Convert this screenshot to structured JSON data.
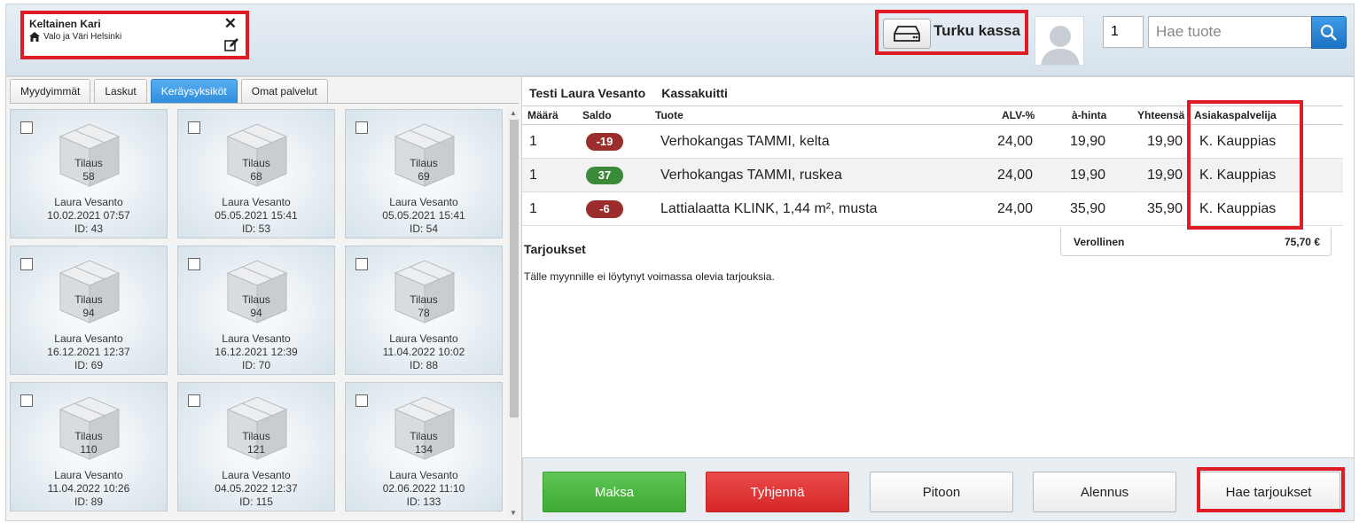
{
  "customer": {
    "name": "Keltainen Kari",
    "store": "Valo ja Väri Helsinki"
  },
  "register": {
    "name": "Turku kassa"
  },
  "search": {
    "quantity": "1",
    "placeholder": "Hae tuote"
  },
  "tabs": [
    {
      "label": "Myydyimmät",
      "active": false
    },
    {
      "label": "Laskut",
      "active": false
    },
    {
      "label": "Keräysyksiköt",
      "active": true
    },
    {
      "label": "Omat palvelut",
      "active": false
    }
  ],
  "cards": [
    {
      "label": "Tilaus",
      "number": "58",
      "name": "Laura Vesanto",
      "date": "10.02.2021 07:57",
      "id": "ID: 43"
    },
    {
      "label": "Tilaus",
      "number": "68",
      "name": "Laura Vesanto",
      "date": "05.05.2021 15:41",
      "id": "ID: 53"
    },
    {
      "label": "Tilaus",
      "number": "69",
      "name": "Laura Vesanto",
      "date": "05.05.2021 15:41",
      "id": "ID: 54"
    },
    {
      "label": "Tilaus",
      "number": "94",
      "name": "Laura Vesanto",
      "date": "16.12.2021 12:37",
      "id": "ID: 69"
    },
    {
      "label": "Tilaus",
      "number": "94",
      "name": "Laura Vesanto",
      "date": "16.12.2021 12:39",
      "id": "ID: 70"
    },
    {
      "label": "Tilaus",
      "number": "78",
      "name": "Laura Vesanto",
      "date": "11.04.2022 10:02",
      "id": "ID: 88"
    },
    {
      "label": "Tilaus",
      "number": "110",
      "name": "Laura Vesanto",
      "date": "11.04.2022 10:26",
      "id": "ID: 89"
    },
    {
      "label": "Tilaus",
      "number": "121",
      "name": "Laura Vesanto",
      "date": "04.05.2022 12:37",
      "id": "ID: 115"
    },
    {
      "label": "Tilaus",
      "number": "134",
      "name": "Laura Vesanto",
      "date": "02.06.2022 11:10",
      "id": "ID: 133"
    }
  ],
  "receipt": {
    "customer": "Testi Laura Vesanto",
    "type": "Kassakuitti",
    "columns": {
      "qty": "Määrä",
      "stock": "Saldo",
      "product": "Tuote",
      "vat": "ALV-%",
      "unit_price": "à-hinta",
      "total": "Yhteensä",
      "service": "Asiakaspalvelija"
    },
    "rows": [
      {
        "qty": "1",
        "stock": "-19",
        "stock_color": "#9b2d2d",
        "product": "Verhokangas TAMMI, kelta",
        "vat": "24,00",
        "unit_price": "19,90",
        "total": "19,90",
        "service": "K. Kauppias"
      },
      {
        "qty": "1",
        "stock": "37",
        "stock_color": "#3a8a3a",
        "product": "Verhokangas TAMMI, ruskea",
        "vat": "24,00",
        "unit_price": "19,90",
        "total": "19,90",
        "service": "K. Kauppias"
      },
      {
        "qty": "1",
        "stock": "-6",
        "stock_color": "#9b2d2d",
        "product": "Lattialaatta KLINK, 1,44 m², musta",
        "vat": "24,00",
        "unit_price": "35,90",
        "total": "35,90",
        "service": "K. Kauppias"
      }
    ],
    "total_label": "Verollinen",
    "total_value": "75,70 €"
  },
  "offers": {
    "title": "Tarjoukset",
    "text": "Tälle myynnille ei löytynyt voimassa olevia tarjouksia."
  },
  "actions": {
    "pay": "Maksa",
    "clear": "Tyhjennä",
    "hold": "Pitoon",
    "discount": "Alennus",
    "fetch_offers": "Hae tarjoukset"
  },
  "colors": {
    "highlight": "#e01b24",
    "accent": "#2f8ddc",
    "pay": "#4cb742",
    "clear": "#dc3030"
  }
}
